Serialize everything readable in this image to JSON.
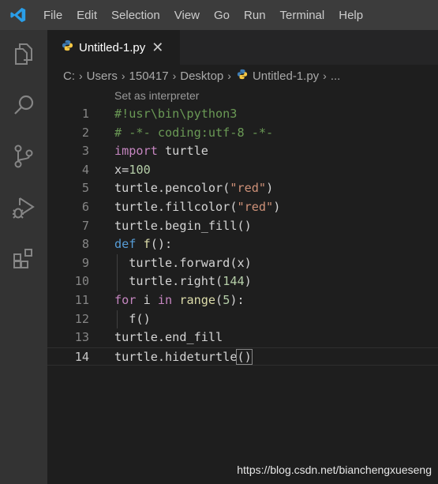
{
  "menu": [
    "File",
    "Edit",
    "Selection",
    "View",
    "Go",
    "Run",
    "Terminal",
    "Help"
  ],
  "activity_icons": [
    "explorer-icon",
    "search-icon",
    "source-control-icon",
    "run-debug-icon",
    "extensions-icon"
  ],
  "tab": {
    "label": "Untitled-1.py",
    "close_glyph": "✕"
  },
  "breadcrumb": [
    "C:",
    "Users",
    "150417",
    "Desktop",
    "Untitled-1.py",
    "..."
  ],
  "codelens": "Set as interpreter",
  "lines": [
    {
      "num": "1",
      "tokens": [
        {
          "t": "#!usr\\bin\\python3",
          "c": "cmt"
        }
      ]
    },
    {
      "num": "2",
      "tokens": [
        {
          "t": "# -*- coding:utf-8 -*-",
          "c": "cmt"
        }
      ]
    },
    {
      "num": "3",
      "tokens": [
        {
          "t": "import",
          "c": "kw"
        },
        {
          "t": " turtle",
          "c": "plain"
        }
      ]
    },
    {
      "num": "4",
      "tokens": [
        {
          "t": "x",
          "c": "plain"
        },
        {
          "t": "=",
          "c": "op"
        },
        {
          "t": "100",
          "c": "num"
        }
      ]
    },
    {
      "num": "5",
      "tokens": [
        {
          "t": "turtle",
          "c": "plain"
        },
        {
          "t": ".",
          "c": "op"
        },
        {
          "t": "pencolor",
          "c": "plain"
        },
        {
          "t": "(",
          "c": "op"
        },
        {
          "t": "\"red\"",
          "c": "str"
        },
        {
          "t": ")",
          "c": "op"
        }
      ]
    },
    {
      "num": "6",
      "tokens": [
        {
          "t": "turtle",
          "c": "plain"
        },
        {
          "t": ".",
          "c": "op"
        },
        {
          "t": "fillcolor",
          "c": "plain"
        },
        {
          "t": "(",
          "c": "op"
        },
        {
          "t": "\"red\"",
          "c": "str"
        },
        {
          "t": ")",
          "c": "op"
        }
      ]
    },
    {
      "num": "7",
      "tokens": [
        {
          "t": "turtle",
          "c": "plain"
        },
        {
          "t": ".",
          "c": "op"
        },
        {
          "t": "begin_fill",
          "c": "plain"
        },
        {
          "t": "()",
          "c": "op"
        }
      ]
    },
    {
      "num": "8",
      "tokens": [
        {
          "t": "def",
          "c": "kw2"
        },
        {
          "t": " ",
          "c": "plain"
        },
        {
          "t": "f",
          "c": "fn"
        },
        {
          "t": "():",
          "c": "op"
        }
      ]
    },
    {
      "num": "9",
      "tokens": [
        {
          "t": "  turtle",
          "c": "plain"
        },
        {
          "t": ".",
          "c": "op"
        },
        {
          "t": "forward",
          "c": "plain"
        },
        {
          "t": "(x)",
          "c": "op"
        }
      ]
    },
    {
      "num": "10",
      "tokens": [
        {
          "t": "  turtle",
          "c": "plain"
        },
        {
          "t": ".",
          "c": "op"
        },
        {
          "t": "right",
          "c": "plain"
        },
        {
          "t": "(",
          "c": "op"
        },
        {
          "t": "144",
          "c": "num"
        },
        {
          "t": ")",
          "c": "op"
        }
      ]
    },
    {
      "num": "11",
      "tokens": [
        {
          "t": "for",
          "c": "kw"
        },
        {
          "t": " i ",
          "c": "plain"
        },
        {
          "t": "in",
          "c": "kw"
        },
        {
          "t": " ",
          "c": "plain"
        },
        {
          "t": "range",
          "c": "fn"
        },
        {
          "t": "(",
          "c": "op"
        },
        {
          "t": "5",
          "c": "num"
        },
        {
          "t": "):",
          "c": "op"
        }
      ]
    },
    {
      "num": "12",
      "tokens": [
        {
          "t": "  f()",
          "c": "plain"
        }
      ]
    },
    {
      "num": "13",
      "tokens": [
        {
          "t": "turtle",
          "c": "plain"
        },
        {
          "t": ".",
          "c": "op"
        },
        {
          "t": "end_fill",
          "c": "plain"
        }
      ]
    },
    {
      "num": "14",
      "tokens": [
        {
          "t": "turtle",
          "c": "plain"
        },
        {
          "t": ".",
          "c": "op"
        },
        {
          "t": "hideturtle",
          "c": "plain"
        },
        {
          "t": "()",
          "c": "op",
          "match": true
        }
      ]
    }
  ],
  "current_line": "14",
  "watermark": "https://blog.csdn.net/bianchengxueseng",
  "colors": {
    "accent": "#0078d4",
    "python_blue": "#3e7cb5",
    "python_yellow": "#f7c844"
  }
}
